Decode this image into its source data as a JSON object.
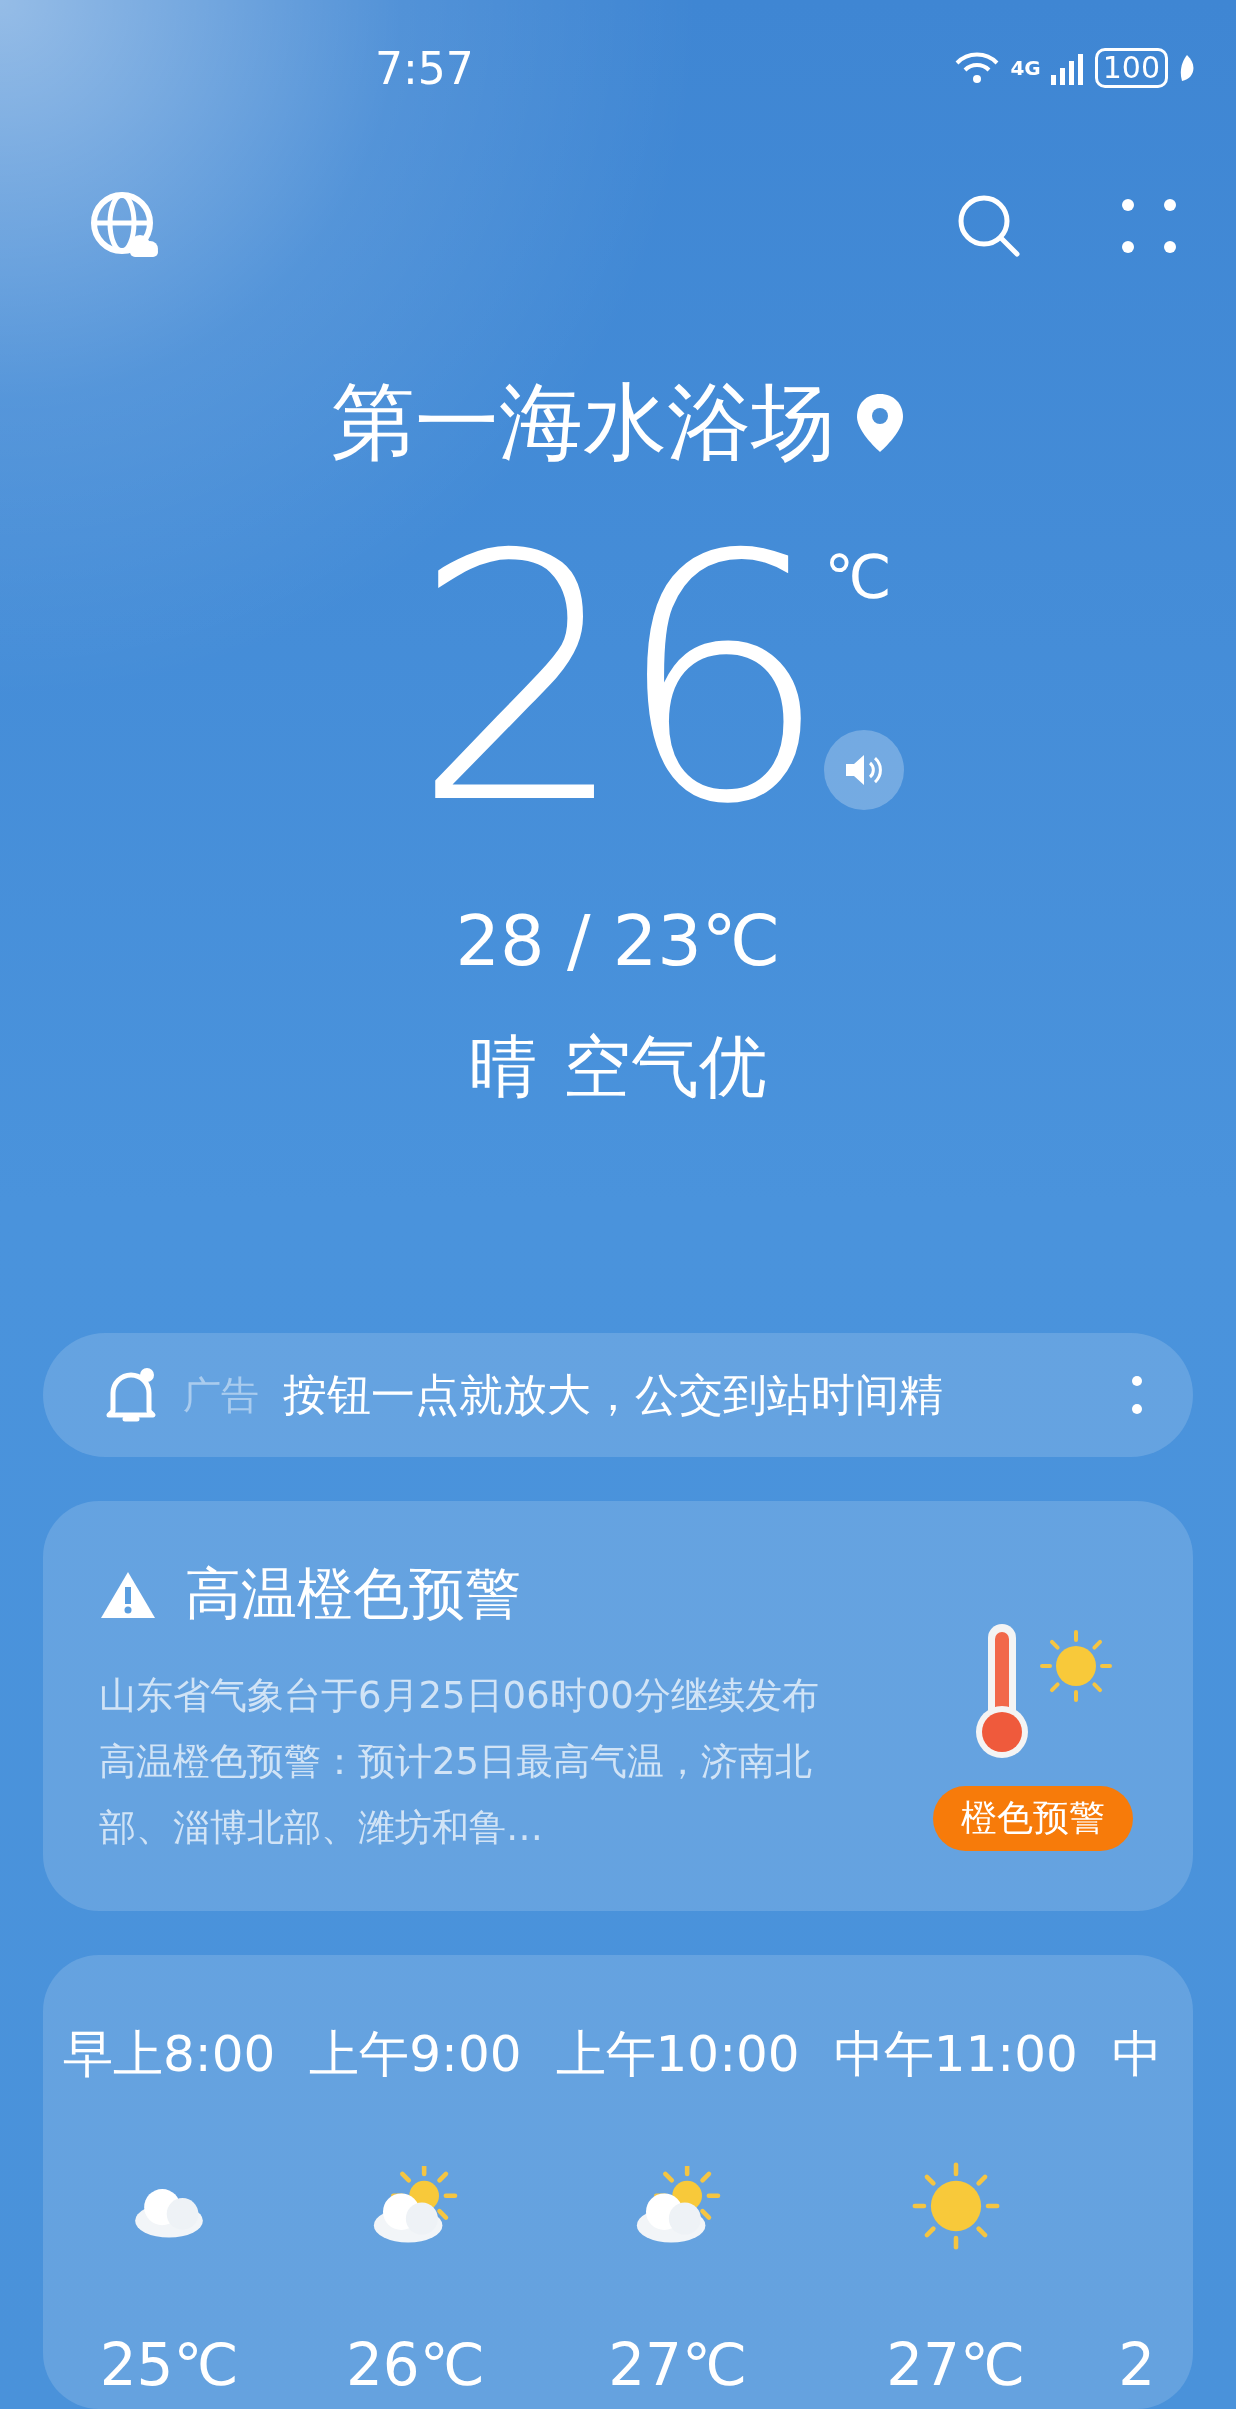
{
  "status_bar": {
    "time": "7:57",
    "network": "4G",
    "battery": "100"
  },
  "location": {
    "name": "第一海水浴场"
  },
  "current": {
    "temperature": "26",
    "unit": "℃",
    "range": "28 / 23℃",
    "condition": "晴",
    "air_quality": "空气优"
  },
  "ad_banner": {
    "label": "广告",
    "text": "按钮一点就放大，公交到站时间精"
  },
  "alert": {
    "title": "高温橙色预警",
    "body": "山东省气象台于6月25日06时00分继续发布高温橙色预警：预计25日最高气温，济南北部、淄博北部、潍坊和鲁…",
    "badge": "橙色预警"
  },
  "hourly": [
    {
      "time": "早上8:00",
      "kind": "cloudy",
      "temperature": "25℃"
    },
    {
      "time": "上午9:00",
      "kind": "partly_cloudy",
      "temperature": "26℃"
    },
    {
      "time": "上午10:00",
      "kind": "partly_cloudy",
      "temperature": "27℃"
    },
    {
      "time": "中午11:00",
      "kind": "sunny",
      "temperature": "27℃"
    },
    {
      "time": "中",
      "temperature": "2"
    }
  ]
}
